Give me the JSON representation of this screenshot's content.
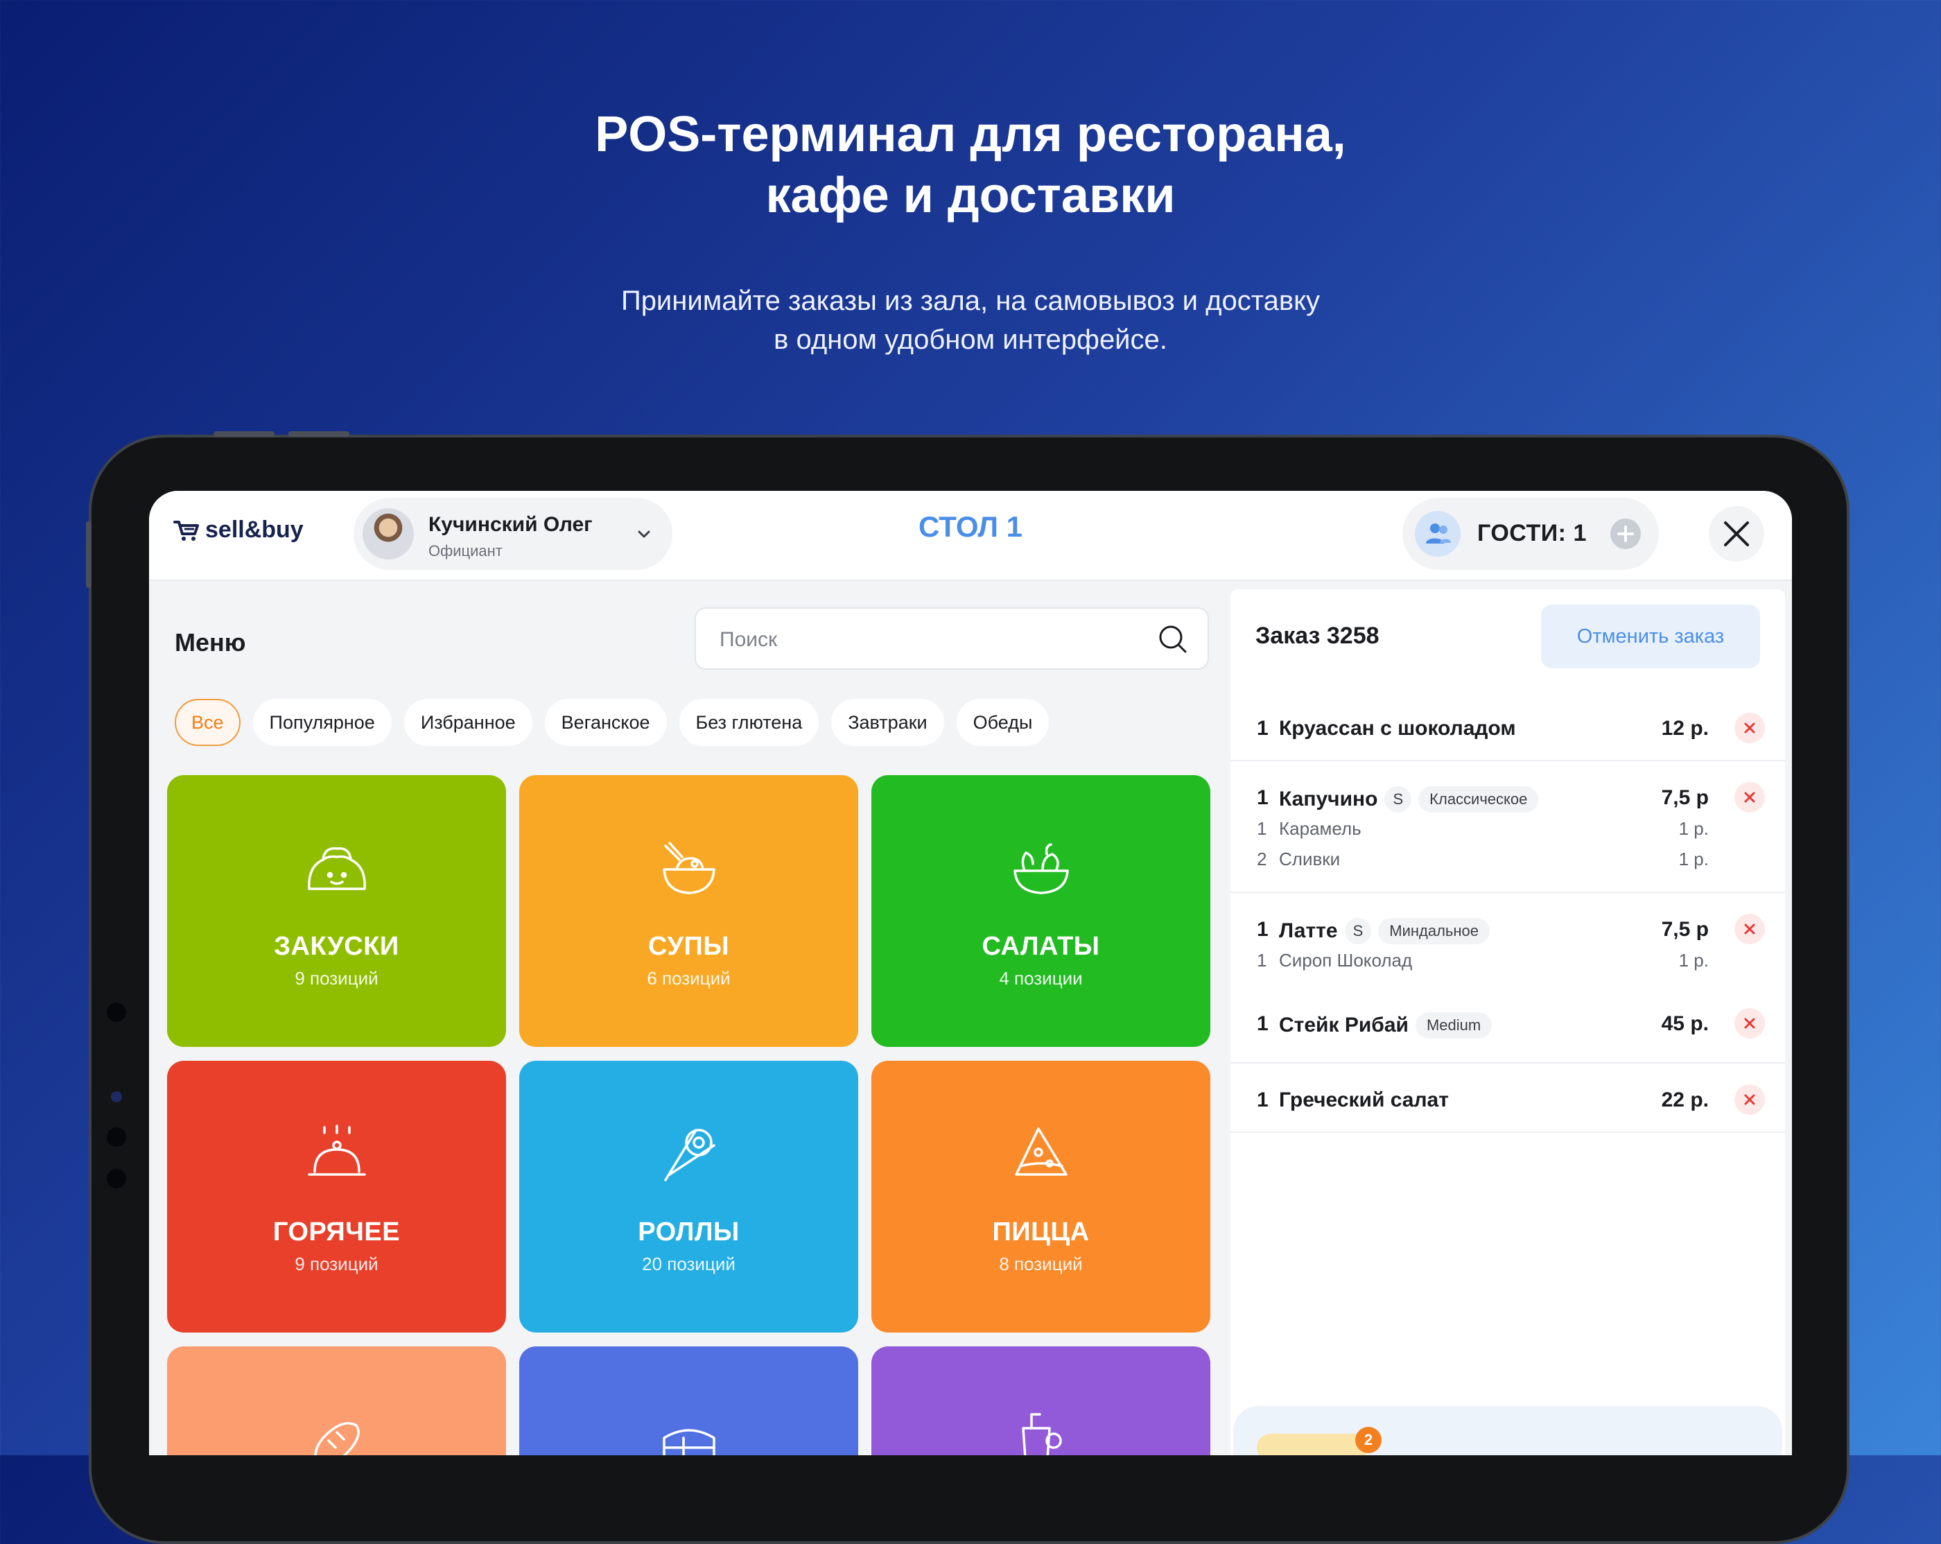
{
  "hero": {
    "title_line1": "POS-терминал для ресторана,",
    "title_line2": "кафе и доставки",
    "subtitle_line1": "Принимайте заказы из зала, на самовывоз и доставку",
    "subtitle_line2": "в одном удобном интерфейсе."
  },
  "header": {
    "logo": "sell&buy",
    "user_name": "Кучинский Олег",
    "user_role": "Официант",
    "table_title": "СТОЛ 1",
    "guests_label": "ГОСТИ: 1"
  },
  "menu": {
    "title": "Меню",
    "search_placeholder": "Поиск",
    "chips": [
      "Все",
      "Популярное",
      "Избранное",
      "Веганское",
      "Без глютена",
      "Завтраки",
      "Обеды"
    ],
    "active_chip": "Все",
    "categories": [
      {
        "name": "ЗАКУСКИ",
        "count": "9 позиций",
        "color": "#8fbe00",
        "icon": "snack-icon"
      },
      {
        "name": "СУПЫ",
        "count": "6 позиций",
        "color": "#f8a825",
        "icon": "soup-icon"
      },
      {
        "name": "САЛАТЫ",
        "count": "4 позиции",
        "color": "#22bb22",
        "icon": "salad-icon"
      },
      {
        "name": "ГОРЯЧЕЕ",
        "count": "9 позиций",
        "color": "#e8402a",
        "icon": "cloche-icon"
      },
      {
        "name": "РОЛЛЫ",
        "count": "20 позиций",
        "color": "#24aee3",
        "icon": "roll-icon"
      },
      {
        "name": "ПИЦЦА",
        "count": "8 позиций",
        "color": "#fb8a2a",
        "icon": "pizza-icon"
      },
      {
        "name": "",
        "count": "",
        "color": "#fb9d6f",
        "icon": "bread-icon"
      },
      {
        "name": "",
        "count": "",
        "color": "#5171e3",
        "icon": "cake-icon"
      },
      {
        "name": "",
        "count": "",
        "color": "#925ad9",
        "icon": "drink-icon"
      }
    ]
  },
  "order": {
    "title": "Заказ 3258",
    "cancel_label": "Отменить заказ",
    "items": [
      {
        "qty": "1",
        "name": "Круассан с шоколадом",
        "size": "",
        "option": "",
        "price": "12 р.",
        "modifiers": []
      },
      {
        "qty": "1",
        "name": "Капучино",
        "size": "S",
        "option": "Классическое",
        "price": "7,5 р",
        "modifiers": [
          {
            "qty": "1",
            "name": "Карамель",
            "price": "1 р."
          },
          {
            "qty": "2",
            "name": "Сливки",
            "price": "1 р."
          }
        ]
      },
      {
        "qty": "1",
        "name": "Латте",
        "size": "S",
        "option": "Миндальное",
        "price": "7,5 р",
        "modifiers": [
          {
            "qty": "1",
            "name": "Сироп Шоколад",
            "price": "1 р."
          }
        ]
      },
      {
        "qty": "1",
        "name": "Стейк Рибай",
        "size": "",
        "option": "Medium",
        "price": "45 р.",
        "modifiers": []
      },
      {
        "qty": "1",
        "name": "Греческий салат",
        "size": "",
        "option": "",
        "price": "22 р.",
        "modifiers": []
      }
    ],
    "footer_badge": "2"
  },
  "colors": {
    "accent": "#4a8ee8",
    "active_chip": "#f07d12",
    "remove": "#e53935"
  }
}
